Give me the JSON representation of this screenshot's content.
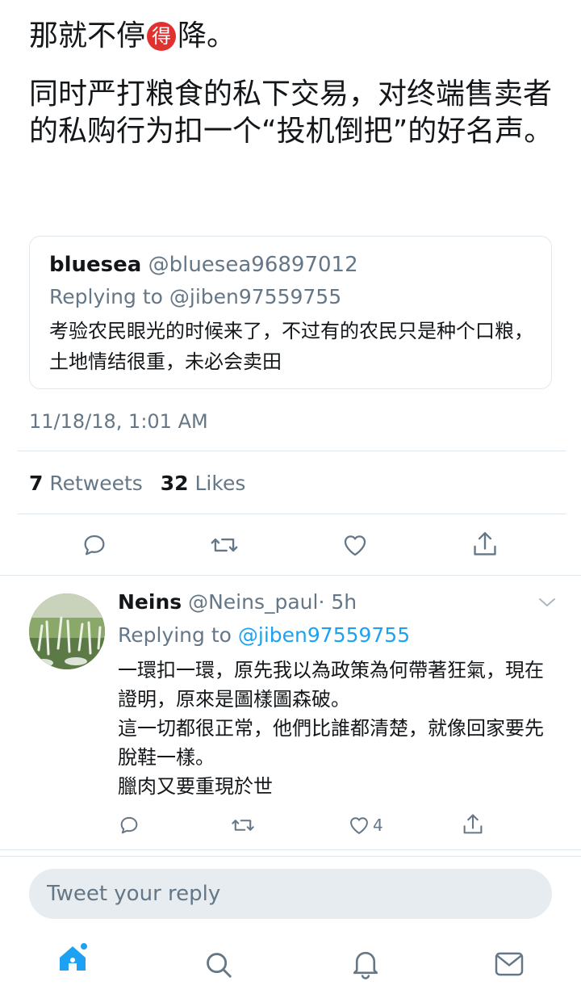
{
  "tweet": {
    "line1_before": "那就不停",
    "special_char": "得",
    "line1_after": "降。",
    "paragraph": "同时严打粮食的私下交易，对终端售卖者的私购行为扣一个“投机倒把”的好名声。"
  },
  "quoted_tweet": {
    "name": "bluesea",
    "handle": "@bluesea96897012",
    "replying_to": "Replying to @jiben97559755",
    "text": "考验农民眼光的时候来了，不过有的农民只是种个口粮，土地情结很重，未必会卖田"
  },
  "timestamp": "11/18/18, 1:01 AM",
  "stats": {
    "retweets_count": "7",
    "retweets_label": "Retweets",
    "likes_count": "32",
    "likes_label": "Likes"
  },
  "reply": {
    "name": "Neins",
    "handle": "@Neins_paul",
    "time": "· 5h",
    "replying_prefix": "Replying to ",
    "replying_to": "@jiben97559755",
    "text_lines": [
      "一環扣一環，原先我以為政策為何帶著狂氣，現在證明，原來是圖樣圖森破。",
      "這一切都很正常，他們比誰都清楚，就像回家要先脫鞋一樣。",
      "臘肉又要重現於世"
    ],
    "like_count": "4"
  },
  "composer": {
    "placeholder": "Tweet your reply"
  },
  "icons": {
    "comment": "comment-icon",
    "retweet": "retweet-icon",
    "like": "heart-icon",
    "share": "share-icon",
    "chevron": "chevron-down-icon",
    "home": "home-icon",
    "search": "search-icon",
    "notifications": "bell-icon",
    "messages": "mail-icon"
  },
  "colors": {
    "accent": "#1da1f2",
    "text": "#14171a",
    "muted": "#657786",
    "special_char_bg": "#e0312f"
  }
}
